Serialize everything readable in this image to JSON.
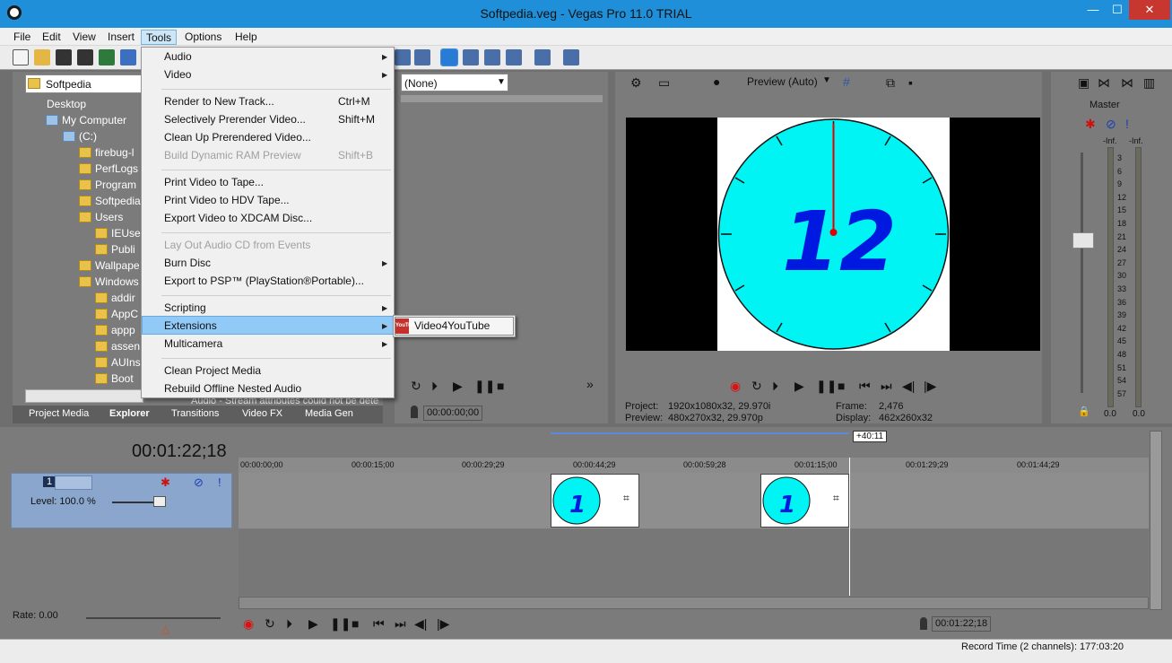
{
  "window": {
    "title": "Softpedia.veg - Vegas Pro 11.0 TRIAL",
    "minimize": "—",
    "maximize": "☐",
    "close": "✕"
  },
  "menubar": [
    "File",
    "Edit",
    "View",
    "Insert",
    "Tools",
    "Options",
    "Help"
  ],
  "explorer": {
    "address": "Softpedia",
    "tree": [
      {
        "label": "Desktop"
      },
      {
        "label": "My Computer"
      },
      {
        "label": "(C:)"
      },
      {
        "label": "firebug-l"
      },
      {
        "label": "PerfLogs"
      },
      {
        "label": "Program"
      },
      {
        "label": "Softpedia"
      },
      {
        "label": "Users"
      },
      {
        "label": "IEUse"
      },
      {
        "label": "Publi"
      },
      {
        "label": "Wallpape"
      },
      {
        "label": "Windows"
      },
      {
        "label": "addir"
      },
      {
        "label": "AppC"
      },
      {
        "label": "appp"
      },
      {
        "label": "assen"
      },
      {
        "label": "AUIns"
      },
      {
        "label": "Boot"
      }
    ],
    "status_text": "Audio - Stream attributes could not be determ",
    "tabs": [
      "Project Media",
      "Explorer",
      "Transitions",
      "Video FX",
      "Media Gen"
    ]
  },
  "trimmer": {
    "select_value": "(None)",
    "time": "00:00:00;00"
  },
  "preview": {
    "mode": "Preview (Auto)",
    "clock_number": "12",
    "project_label": "Project:",
    "project_value": "1920x1080x32, 29.970i",
    "preview_label": "Preview:",
    "preview_value": "480x270x32, 29.970p",
    "frame_label": "Frame:",
    "frame_value": "2,476",
    "display_label": "Display:",
    "display_value": "462x260x32"
  },
  "mixer": {
    "master_label": "Master",
    "inf_left": "-Inf.",
    "inf_right": "-Inf.",
    "scale": [
      "3",
      "6",
      "9",
      "12",
      "15",
      "18",
      "21",
      "24",
      "27",
      "30",
      "33",
      "36",
      "39",
      "42",
      "45",
      "48",
      "51",
      "54",
      "57"
    ],
    "bottom_left": "0.0",
    "bottom_right": "0.0"
  },
  "timeline": {
    "timecode": "00:01:22;18",
    "track_number": "1",
    "level": "Level: 100.0 %",
    "region_label": "+40:11",
    "ruler": [
      "00:00:00;00",
      "00:00:15;00",
      "00:00:29;29",
      "00:00:44;29",
      "00:00:59;28",
      "00:01:15;00",
      "00:01:29;29",
      "00:01:44;29"
    ],
    "rate": "Rate: 0.00",
    "transport_time": "00:01:22;18"
  },
  "status": {
    "record_time": "Record Time (2 channels): 177:03:20"
  },
  "tools_menu": {
    "items": [
      {
        "label": "Audio",
        "shortcut": "",
        "submenu": true,
        "disabled": false
      },
      {
        "label": "Video",
        "shortcut": "",
        "submenu": true,
        "disabled": false
      },
      {
        "label": "Render to New Track...",
        "shortcut": "Ctrl+M",
        "submenu": false,
        "disabled": false
      },
      {
        "label": "Selectively Prerender Video...",
        "shortcut": "Shift+M",
        "submenu": false,
        "disabled": false
      },
      {
        "label": "Clean Up Prerendered Video...",
        "shortcut": "",
        "submenu": false,
        "disabled": false
      },
      {
        "label": "Build Dynamic RAM Preview",
        "shortcut": "Shift+B",
        "submenu": false,
        "disabled": true
      },
      {
        "label": "Print Video to Tape...",
        "shortcut": "",
        "submenu": false,
        "disabled": false
      },
      {
        "label": "Print Video to HDV Tape...",
        "shortcut": "",
        "submenu": false,
        "disabled": false
      },
      {
        "label": "Export Video to XDCAM Disc...",
        "shortcut": "",
        "submenu": false,
        "disabled": false
      },
      {
        "label": "Lay Out Audio CD from Events",
        "shortcut": "",
        "submenu": false,
        "disabled": true
      },
      {
        "label": "Burn Disc",
        "shortcut": "",
        "submenu": true,
        "disabled": false
      },
      {
        "label": "Export to PSP™ (PlayStation®Portable)...",
        "shortcut": "",
        "submenu": false,
        "disabled": false
      },
      {
        "label": "Scripting",
        "shortcut": "",
        "submenu": true,
        "disabled": false
      },
      {
        "label": "Extensions",
        "shortcut": "",
        "submenu": true,
        "disabled": false
      },
      {
        "label": "Multicamera",
        "shortcut": "",
        "submenu": true,
        "disabled": false
      },
      {
        "label": "Clean Project Media",
        "shortcut": "",
        "submenu": false,
        "disabled": false
      },
      {
        "label": "Rebuild Offline Nested Audio",
        "shortcut": "",
        "submenu": false,
        "disabled": false
      }
    ],
    "extensions_submenu": {
      "label": "Video4YouTube",
      "icon": "YouTube"
    }
  }
}
